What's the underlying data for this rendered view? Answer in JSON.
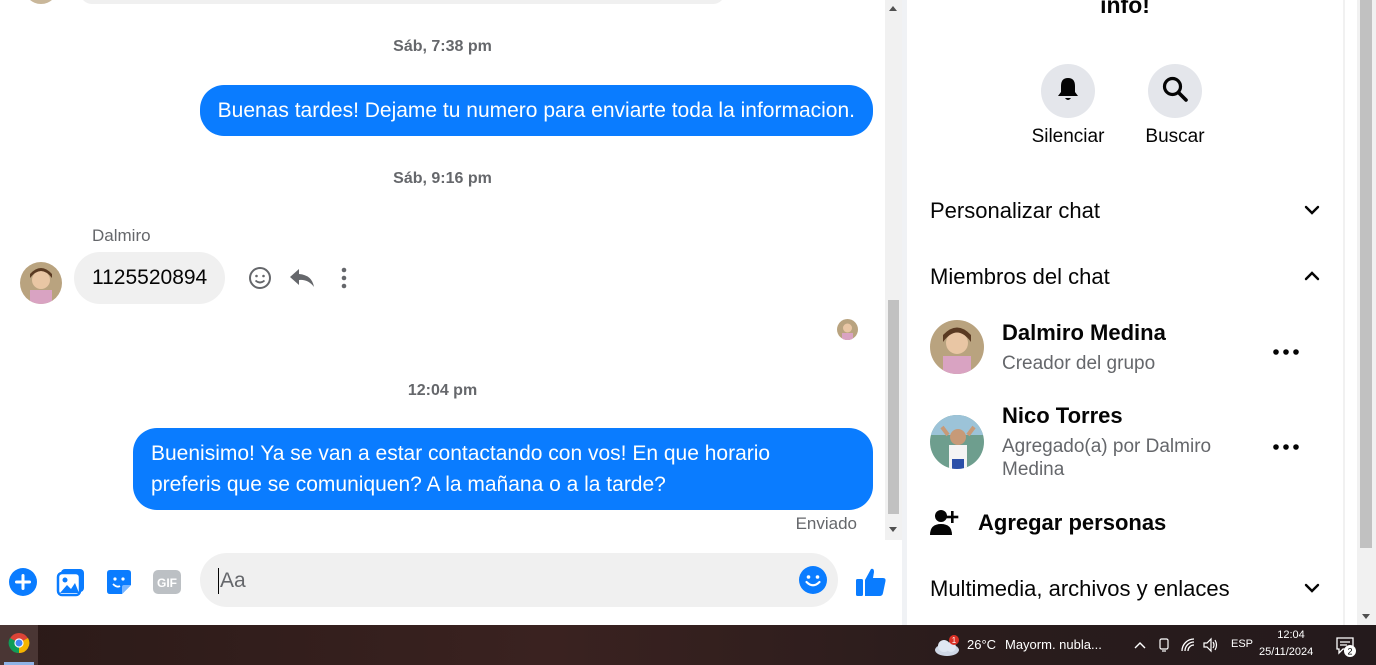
{
  "chat": {
    "messages": [
      {
        "timestamp": "Sáb, 7:38 pm",
        "text": "Buenas tardes! Dejame tu numero para enviarte toda la informacion."
      },
      {
        "timestamp": "Sáb, 9:16 pm",
        "sender": "Dalmiro",
        "text": "1125520894"
      },
      {
        "timestamp": "12:04 pm",
        "text_lines": [
          "Buenisimo! Ya se van a estar contactando con vos! En que horario",
          "preferis que se comuniquen? A la mañana o a la tarde?"
        ],
        "status": "Enviado"
      }
    ],
    "message_actions": [
      "react-icon",
      "reply-icon",
      "more-icon"
    ]
  },
  "composer": {
    "placeholder": "Aa",
    "icons": [
      "plus-icon",
      "image-icon",
      "sticker-icon",
      "gif-icon",
      "emoji-icon",
      "like-icon"
    ],
    "gif_label": "GIF",
    "accent": "#0a7cff"
  },
  "info": {
    "title": "info!",
    "actions": [
      {
        "label": "Silenciar",
        "icon": "bell-icon"
      },
      {
        "label": "Buscar",
        "icon": "search-icon"
      }
    ],
    "sections": {
      "customize": "Personalizar chat",
      "members": "Miembros del chat",
      "media": "Multimedia, archivos y enlaces"
    },
    "members": [
      {
        "name": "Dalmiro Medina",
        "role": "Creador del grupo"
      },
      {
        "name": "Nico Torres",
        "role": "Agregado(a) por Dalmiro Medina"
      }
    ],
    "add_people": "Agregar personas"
  },
  "taskbar": {
    "weather_temp": "26°C",
    "weather_desc": "Mayorm. nubla...",
    "weather_badge": "1",
    "language": "ESP",
    "time": "12:04",
    "date": "25/11/2024",
    "notification_count": "2"
  }
}
